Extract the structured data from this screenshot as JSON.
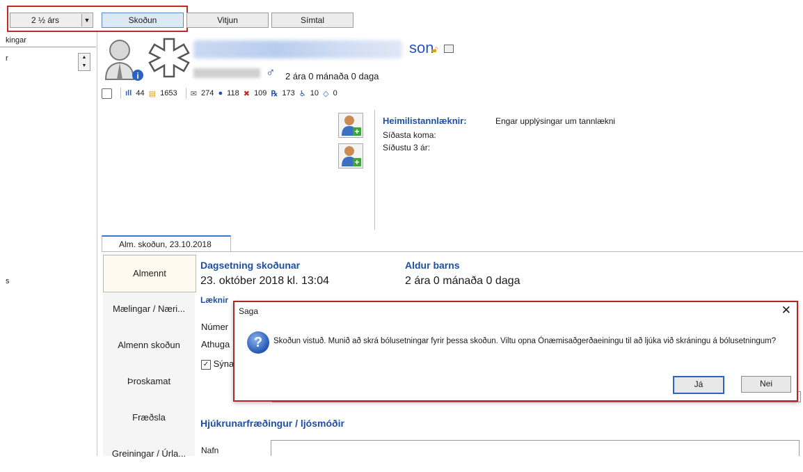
{
  "toolbar": {
    "combo_value": "2 ½ árs",
    "tabs": [
      "Skoðun",
      "Vitjun",
      "Símtal"
    ]
  },
  "left_panel": {
    "header": "kingar",
    "label1": "r",
    "label2": "s"
  },
  "patient": {
    "name_visible": "son",
    "age": "2 ára 0 mánaða 0 daga"
  },
  "counters": {
    "c1": "44",
    "c2": "1653",
    "c3": "274",
    "c4": "118",
    "c5": "109",
    "c6": "173",
    "c7": "10",
    "c8": "0"
  },
  "info": {
    "dentist_label": "Heimilistannlæknir:",
    "dentist_value": "Engar upplýsingar um tannlækni",
    "last_visit_label": "Síðasta koma:",
    "last3_label": "Síðustu 3 ár:"
  },
  "exam_tab": {
    "label": "Alm. skoðun, 23.10.2018"
  },
  "nav": {
    "items": [
      "Almennt",
      "Mælingar / Næri...",
      "Almenn skoðun",
      "Þroskamat",
      "Fræðsla",
      "Greiningar / Úrla..."
    ]
  },
  "content": {
    "date_label": "Dagsetning skoðunar",
    "date_value": "23. október 2018 kl. 13:04",
    "age_label": "Aldur barns",
    "age_value": "2 ára 0 mánaða 0 daga",
    "doctor_label": "Læknir",
    "numer_label": "Númer",
    "athuga_label": "Athuga",
    "syna_label": "Sýna",
    "nurse_label": "Hjúkrunarfræðingur / ljósmóðir",
    "nafn_label": "Nafn"
  },
  "dialog": {
    "title": "Saga",
    "close": "✕",
    "message": "Skoðun vistuð. Munið að skrá bólusetningar fyrir þessa skoðun. Viltu opna Ónæmisaðgerðaeiningu til að ljúka við skráningu á bólusetningum?",
    "yes": "Já",
    "no": "Nei"
  },
  "colors": {
    "accent": "#1f4fa3",
    "highlight_red": "#c62828"
  }
}
